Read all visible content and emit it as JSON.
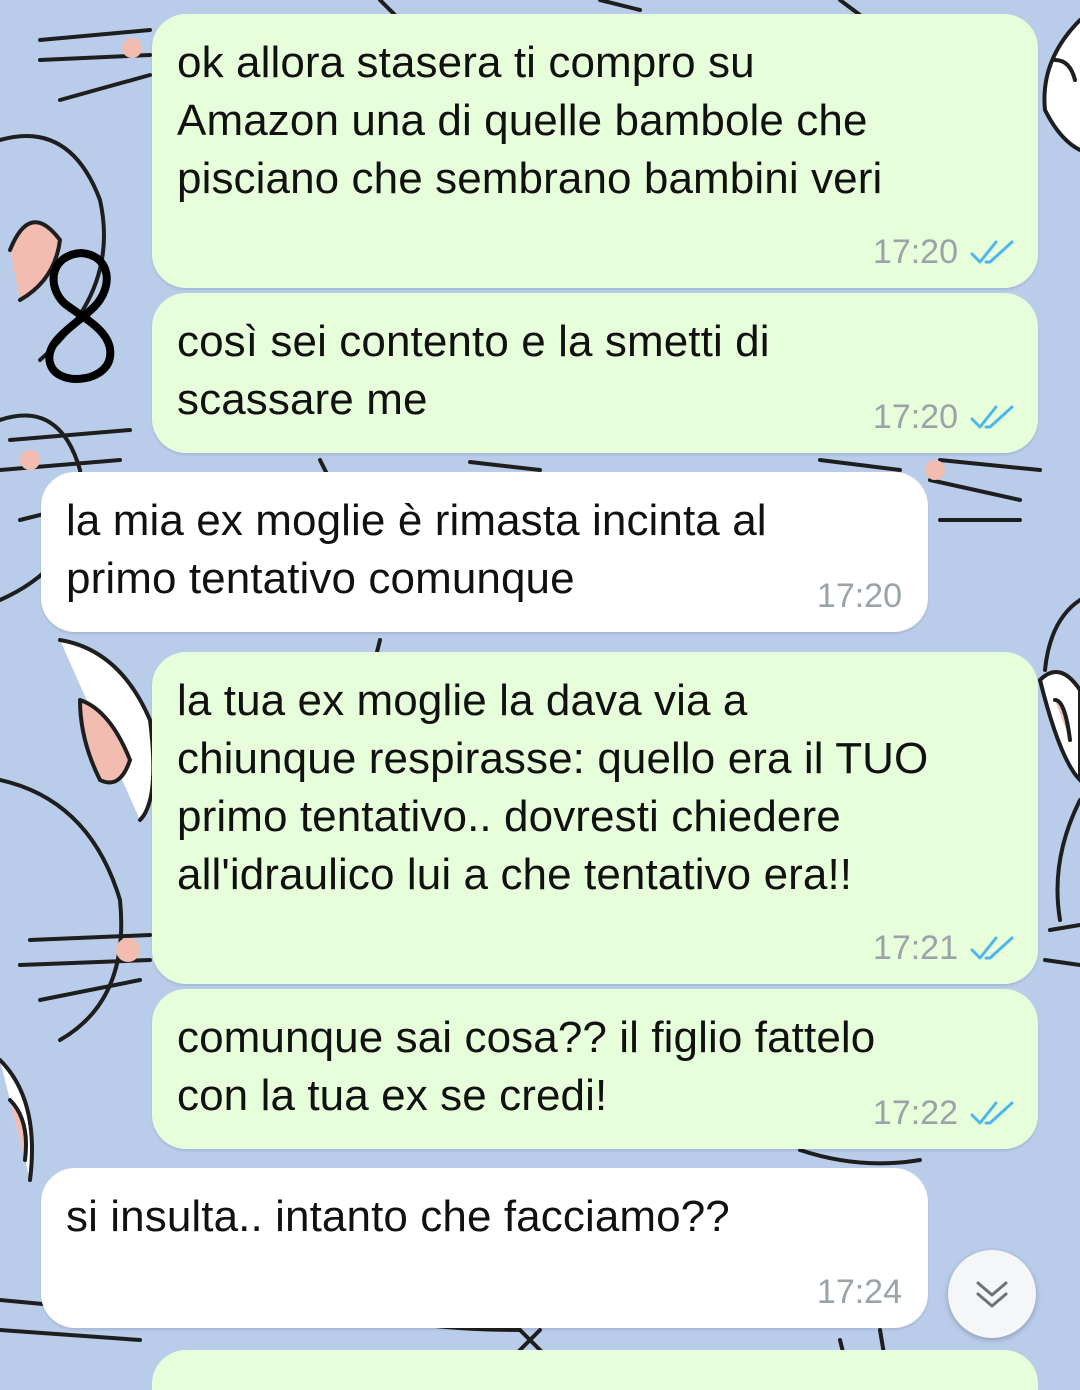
{
  "chat": {
    "messages": [
      {
        "direction": "outgoing",
        "text": "ok allora stasera ti compro su\nAmazon una di quelle bambole che\npisciano che sembrano bambini veri",
        "time": "17:20",
        "status": "read"
      },
      {
        "direction": "outgoing",
        "text": "così sei contento e la smetti di\nscassare me",
        "time": "17:20",
        "status": "read"
      },
      {
        "direction": "incoming",
        "text": "la mia ex moglie è rimasta incinta al\nprimo tentativo comunque",
        "time": "17:20"
      },
      {
        "direction": "outgoing",
        "text": "la tua ex moglie la dava via a\nchiunque respirasse: quello era il TUO\nprimo tentativo.. dovresti chiedere\nall'idraulico lui a che tentativo era!!",
        "time": "17:21",
        "status": "read"
      },
      {
        "direction": "outgoing",
        "text": "comunque sai cosa?? il figlio fattelo\ncon la tua ex se credi!",
        "time": "17:22",
        "status": "read"
      },
      {
        "direction": "incoming",
        "text": "si insulta.. intanto che facciamo??",
        "time": "17:24"
      }
    ],
    "annotation": "8",
    "scroll_button_icon": "double-chevron-down-icon",
    "read_tick_icon": "double-check-icon"
  },
  "colors": {
    "wallpaper": "#b9cdeb",
    "outgoing_bubble": "#e7fedb",
    "incoming_bubble": "#ffffff",
    "read_tick": "#4fb6ec",
    "timestamp": "#9aa3a8"
  }
}
